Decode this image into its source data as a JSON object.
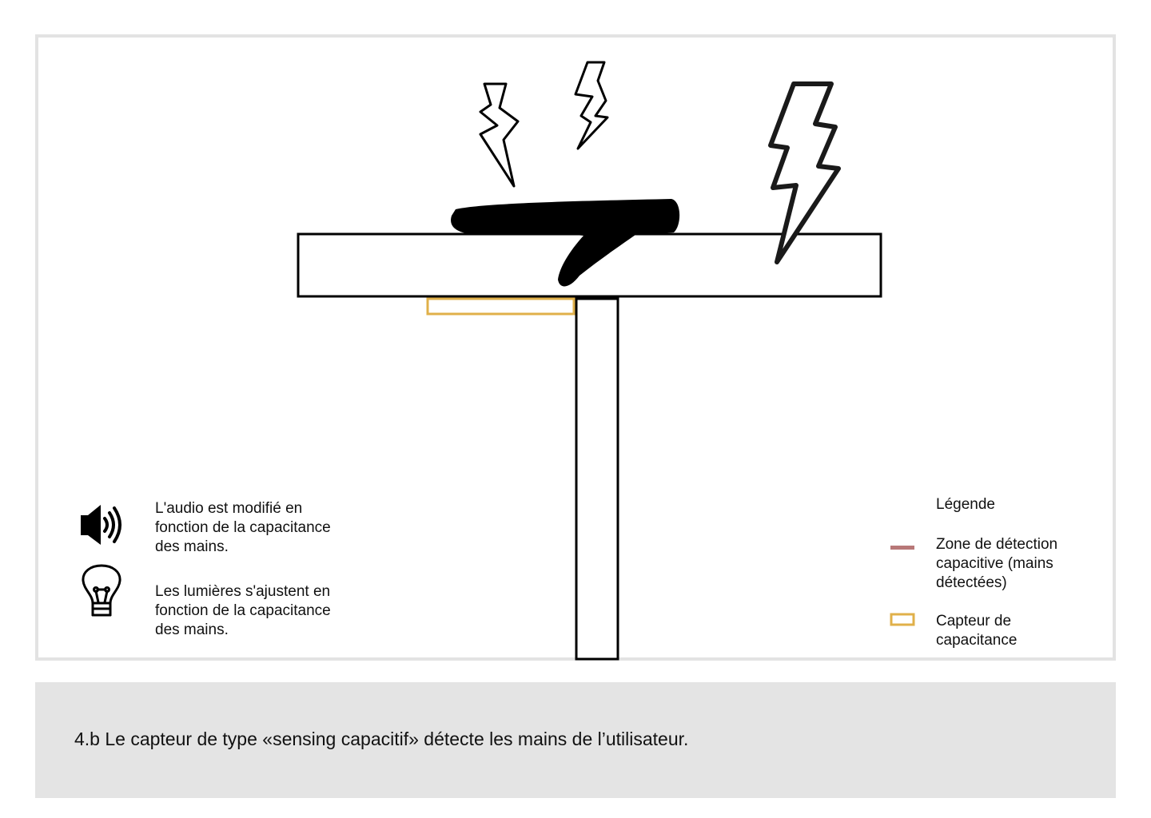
{
  "icon_legend": {
    "audio": {
      "icon": "speaker-icon",
      "text": "L'audio est modifié en\nfonction de la capacitance\ndes mains."
    },
    "lights": {
      "icon": "lightbulb-icon",
      "text": "Les lumières s'ajustent en\nfonction de la capacitance\ndes mains."
    }
  },
  "legend": {
    "title": "Légende",
    "items": [
      {
        "text": "Zone de détection\ncapacitive (mains\ndétectées)",
        "color": "#b87878"
      },
      {
        "text": "Capteur de\ncapacitance",
        "color": "#e0b04a"
      }
    ]
  },
  "caption": "4.b Le capteur de type «sensing capacitif» détecte les mains de l’utilisateur.",
  "colors": {
    "sensor": "#e0b04a",
    "detection_zone": "#b87878",
    "caption_background": "#e4e4e4",
    "frame_border": "#e3e3e3"
  }
}
